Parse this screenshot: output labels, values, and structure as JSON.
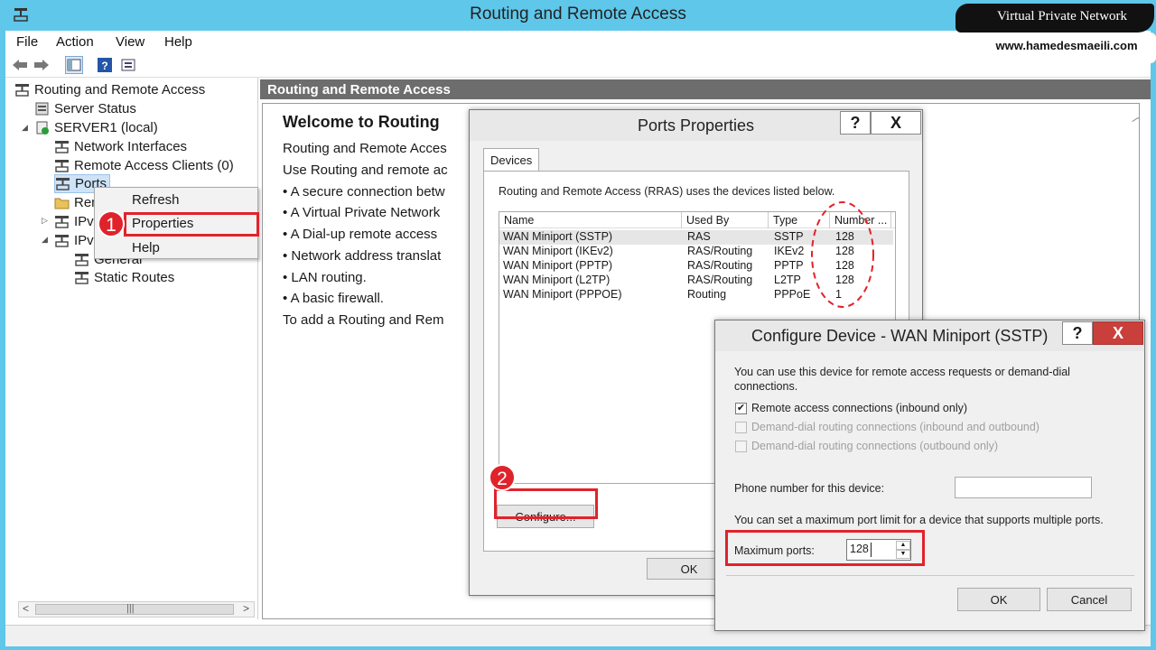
{
  "window": {
    "title": "Routing and Remote Access"
  },
  "menu": [
    "File",
    "Action",
    "View",
    "Help"
  ],
  "tree": {
    "root": "Routing and Remote Access",
    "server_status": "Server Status",
    "server": "SERVER1 (local)",
    "network_interfaces": "Network Interfaces",
    "remote_access_clients": "Remote Access Clients (0)",
    "ports": "Ports",
    "rem": "Rem",
    "ipv4": "IPv4",
    "ipv6": "IPv6",
    "general": "General",
    "static_routes": "Static Routes"
  },
  "context_menu": {
    "refresh": "Refresh",
    "properties": "Properties",
    "help": "Help"
  },
  "main": {
    "header": "Routing and Remote Access",
    "welcome_title": "Welcome to Routing",
    "lines": [
      "Routing and Remote Acces",
      "Use Routing and remote ac",
      "• A secure connection betw",
      "• A Virtual Private Network",
      "• A Dial-up remote access",
      "• Network address translat",
      "• LAN routing.",
      "• A basic firewall.",
      "To add a Routing and Rem"
    ]
  },
  "ports_dialog": {
    "title": "Ports Properties",
    "help_btn": "?",
    "close_btn": "X",
    "tab": "Devices",
    "description": "Routing and Remote Access (RRAS) uses the devices listed below.",
    "columns": [
      "Name",
      "Used By",
      "Type",
      "Number ..."
    ],
    "rows": [
      [
        "WAN Miniport (SSTP)",
        "RAS",
        "SSTP",
        "128"
      ],
      [
        "WAN Miniport (IKEv2)",
        "RAS/Routing",
        "IKEv2",
        "128"
      ],
      [
        "WAN Miniport (PPTP)",
        "RAS/Routing",
        "PPTP",
        "128"
      ],
      [
        "WAN Miniport (L2TP)",
        "RAS/Routing",
        "L2TP",
        "128"
      ],
      [
        "WAN Miniport (PPPOE)",
        "Routing",
        "PPPoE",
        "1"
      ]
    ],
    "configure_btn": "Configure...",
    "ok_btn": "OK"
  },
  "config_dialog": {
    "title": "Configure Device - WAN Miniport (SSTP)",
    "help_btn": "?",
    "close_btn": "X",
    "description_1": "You can use this device for remote access requests or demand-dial",
    "description_2": "connections.",
    "check_remote": "Remote access connections (inbound only)",
    "check_demand_both": "Demand-dial routing connections (inbound and outbound)",
    "check_demand_out": "Demand-dial routing connections (outbound only)",
    "phone_label": "Phone number for this device:",
    "phone_value": "",
    "limit_text": "You can set a maximum port limit for a device that supports multiple ports.",
    "max_ports_label": "Maximum ports:",
    "max_ports_value": "128",
    "ok_btn": "OK",
    "cancel_btn": "Cancel"
  },
  "annotations": {
    "step1": "1",
    "step2": "2"
  },
  "watermark": {
    "line1": "Virtual Private Network",
    "line2": "www.hamedesmaeili.com"
  },
  "colors": {
    "accent_red": "#e0232b",
    "title_bar": "#5ec7ea",
    "pane_header": "#6d6d6d"
  }
}
